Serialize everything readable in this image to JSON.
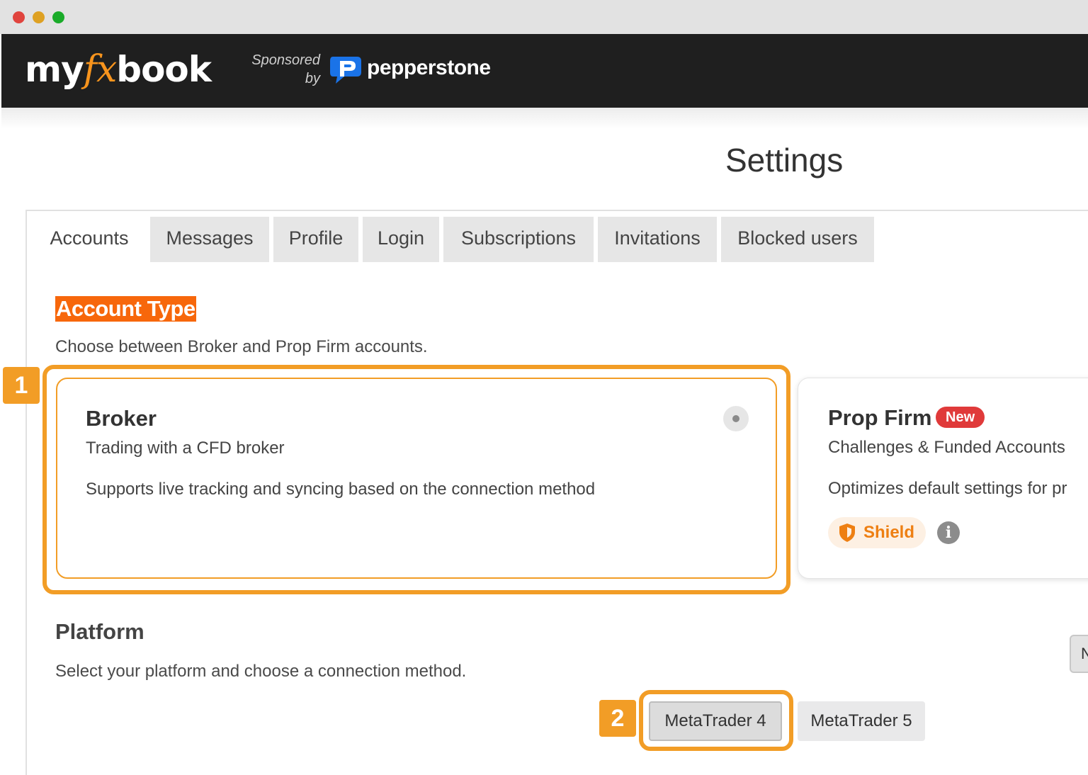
{
  "window": {
    "controls": [
      "close",
      "minimize",
      "maximize"
    ]
  },
  "header": {
    "logo_my": "my",
    "logo_fx": "fx",
    "logo_book": "book",
    "sponsored_line1": "Sponsored",
    "sponsored_line2": "by",
    "sponsor_name": "pepperstone",
    "sponsor_icon": "pepperstone-logo-icon"
  },
  "page": {
    "title": "Settings"
  },
  "tabs": [
    {
      "label": "Accounts",
      "active": true
    },
    {
      "label": "Messages",
      "active": false
    },
    {
      "label": "Profile",
      "active": false
    },
    {
      "label": "Login",
      "active": false
    },
    {
      "label": "Subscriptions",
      "active": false
    },
    {
      "label": "Invitations",
      "active": false
    },
    {
      "label": "Blocked users",
      "active": false
    }
  ],
  "account_type": {
    "title": "Account Type",
    "subtitle": "Choose between Broker and Prop Firm accounts.",
    "broker": {
      "title": "Broker",
      "subtitle": "Trading with a CFD broker",
      "description": "Supports live tracking and syncing based on the connection method",
      "selected": true
    },
    "prop_firm": {
      "title": "Prop Firm",
      "badge": "New",
      "subtitle": "Challenges & Funded Accounts",
      "description": "Optimizes default settings for pr",
      "shield_label": "Shield",
      "info_icon": "i"
    }
  },
  "platform": {
    "title": "Platform",
    "subtitle": "Select your platform and choose a connection method.",
    "options": [
      "MetaTrader 4",
      "MetaTrader 5"
    ],
    "selected": "MetaTrader 4",
    "edge_button_label": "N"
  },
  "callouts": [
    "1",
    "2"
  ],
  "colors": {
    "accent_orange": "#f29d26",
    "highlight_orange": "#f7670b",
    "header_bg": "#1f1f1f",
    "badge_red": "#e03a3a",
    "pepperstone_blue": "#1a73e8"
  }
}
